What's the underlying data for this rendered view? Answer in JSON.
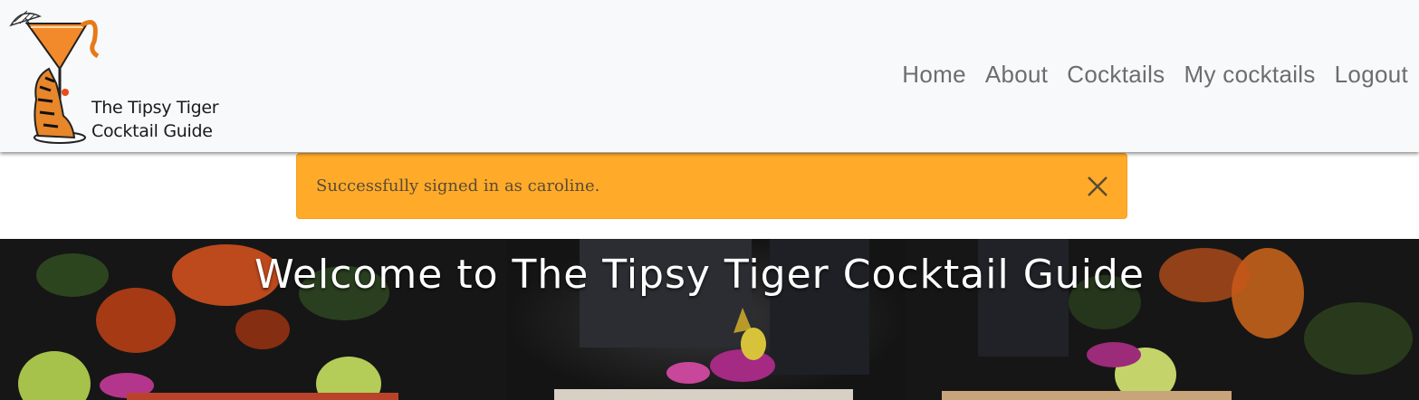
{
  "brand": {
    "line1": "The Tipsy Tiger",
    "line2": "Cocktail Guide",
    "logo_icon": "tiger-cocktail-glass-logo"
  },
  "nav": {
    "items": [
      {
        "label": "Home"
      },
      {
        "label": "About"
      },
      {
        "label": "Cocktails"
      },
      {
        "label": "My cocktails"
      },
      {
        "label": "Logout"
      }
    ]
  },
  "alert": {
    "message": "Successfully signed in as caroline.",
    "close_icon": "close-icon",
    "color": "#ffab29"
  },
  "hero": {
    "title": "Welcome to The Tipsy Tiger Cocktail Guide",
    "background": "cocktails-bar-photo"
  },
  "colors": {
    "navbar_bg": "#f8f9fa",
    "nav_link": "#6d6d6d",
    "alert_bg": "#ffab29"
  }
}
